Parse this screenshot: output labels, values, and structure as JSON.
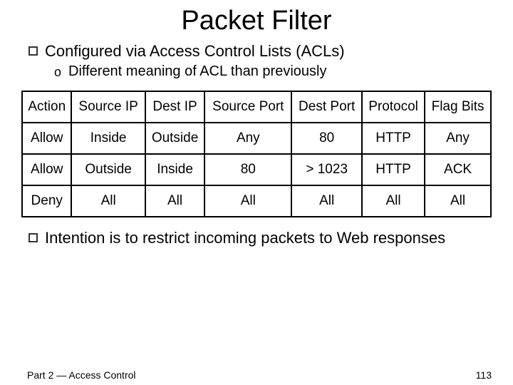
{
  "title": "Packet Filter",
  "bullets": {
    "first": "Configured via Access Control Lists (ACLs)",
    "first_sub": "Different meaning of ACL than previously",
    "second": "Intention is to restrict incoming packets to Web responses"
  },
  "table": {
    "headers": {
      "action": "Action",
      "src_ip": "Source IP",
      "dst_ip": "Dest IP",
      "src_port": "Source Port",
      "dst_port": "Dest Port",
      "protocol": "Protocol",
      "flag_bits": "Flag Bits"
    },
    "rows": [
      {
        "action": "Allow",
        "src_ip": "Inside",
        "dst_ip": "Outside",
        "src_port": "Any",
        "dst_port": "80",
        "protocol": "HTTP",
        "flag_bits": "Any"
      },
      {
        "action": "Allow",
        "src_ip": "Outside",
        "dst_ip": "Inside",
        "src_port": "80",
        "dst_port": "> 1023",
        "protocol": "HTTP",
        "flag_bits": "ACK"
      },
      {
        "action": "Deny",
        "src_ip": "All",
        "dst_ip": "All",
        "src_port": "All",
        "dst_port": "All",
        "protocol": "All",
        "flag_bits": "All"
      }
    ]
  },
  "footer": {
    "left": "Part 2 — Access Control",
    "right": "113"
  }
}
